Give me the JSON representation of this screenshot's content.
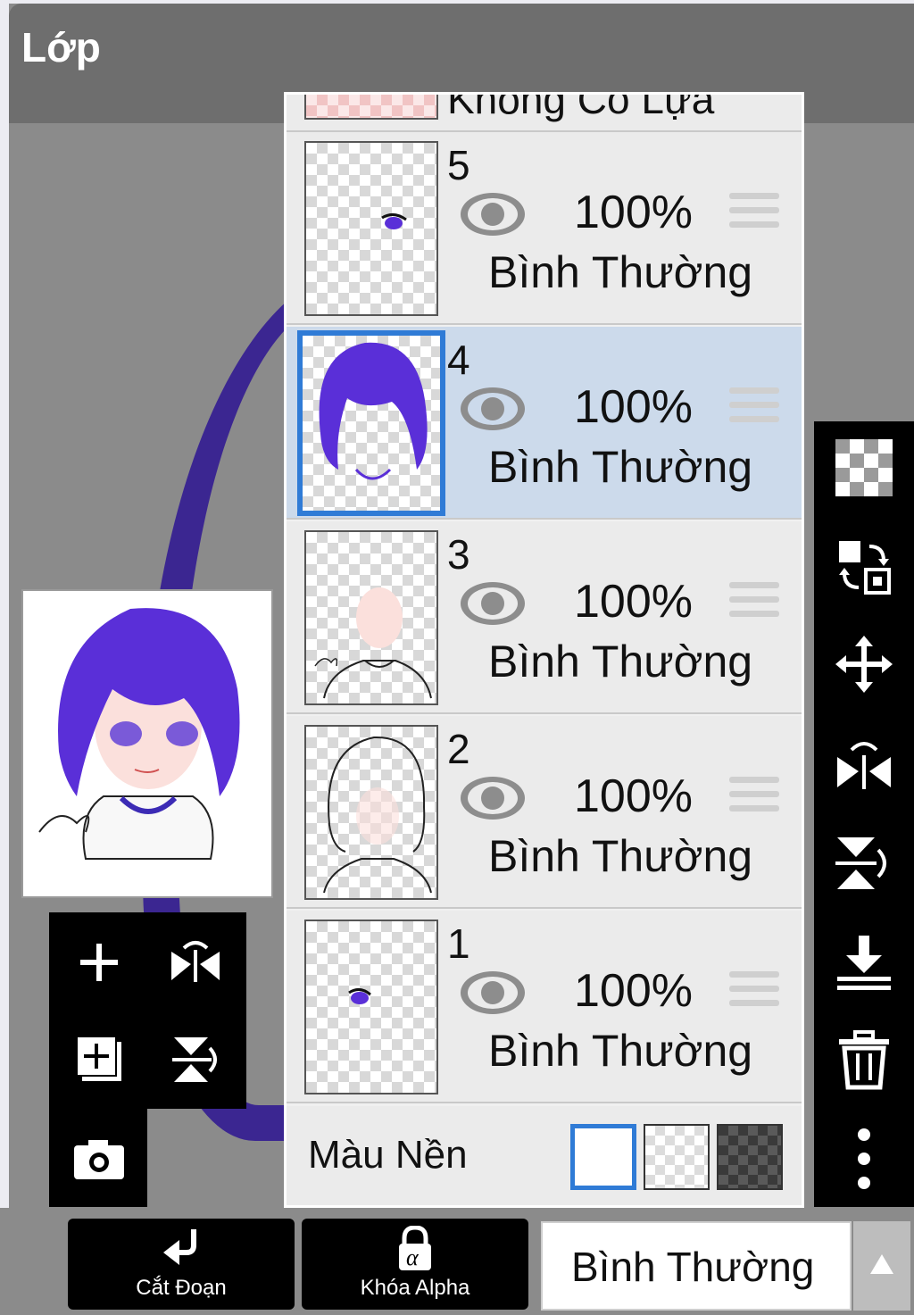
{
  "header": {
    "title": "Lớp"
  },
  "layers_panel": {
    "top_partial_label": "Không Có Lựa Chọn",
    "layers": [
      {
        "number": "5",
        "opacity": "100%",
        "blend_mode": "Bình Thường",
        "visible": true,
        "selected": false
      },
      {
        "number": "4",
        "opacity": "100%",
        "blend_mode": "Bình Thường",
        "visible": true,
        "selected": true
      },
      {
        "number": "3",
        "opacity": "100%",
        "blend_mode": "Bình Thường",
        "visible": true,
        "selected": false
      },
      {
        "number": "2",
        "opacity": "100%",
        "blend_mode": "Bình Thường",
        "visible": true,
        "selected": false
      },
      {
        "number": "1",
        "opacity": "100%",
        "blend_mode": "Bình Thường",
        "visible": true,
        "selected": false
      }
    ],
    "background": {
      "label": "Màu Nền",
      "options": [
        "white",
        "transparent",
        "dark"
      ],
      "selected": "white"
    }
  },
  "bottom_bar": {
    "clip_label": "Cắt Đoạn",
    "alpha_lock_label": "Khóa Alpha",
    "blend_mode_value": "Bình Thường"
  },
  "colors": {
    "accent": "#2f7bd6",
    "selected_row": "#ccdaeb",
    "hair": "#5a2fd8"
  },
  "icons": {
    "left_tools": [
      "plus-icon",
      "flip-horizontal-icon",
      "add-layer-icon",
      "flip-vertical-icon",
      "camera-icon"
    ],
    "right_tools": [
      "checker-icon",
      "swap-icon",
      "move-icon",
      "flip-horizontal-icon",
      "flip-vertical-icon",
      "merge-down-icon",
      "trash-icon",
      "more-icon"
    ]
  }
}
